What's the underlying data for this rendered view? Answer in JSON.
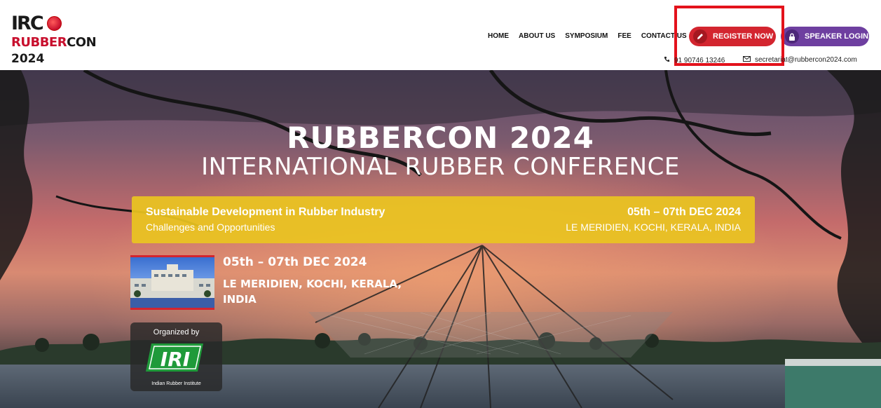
{
  "logo": {
    "line1": "IRC",
    "line2_red": "RUBBER",
    "line2_dark": "CON",
    "line3": "2024"
  },
  "nav": {
    "items": [
      "HOME",
      "ABOUT US",
      "SYMPOSIUM",
      "FEE",
      "CONTACT US"
    ]
  },
  "buttons": {
    "register": "REGISTER NOW",
    "speaker": "SPEAKER LOGIN"
  },
  "contact": {
    "phone": "91 90746 13246",
    "email": "secretariat@rubbercon2024.com"
  },
  "hero": {
    "title": "RUBBERCON 2024",
    "subtitle": "INTERNATIONAL RUBBER CONFERENCE",
    "banner": {
      "left_line1": "Sustainable Development in Rubber Industry",
      "left_line2": "Challenges and Opportunities",
      "right_line1": "05th – 07th DEC 2024",
      "right_line2": "LE MERIDIEN, KOCHI, KERALA, INDIA"
    },
    "venue": {
      "date": "05th – 07th DEC 2024",
      "place_line1": "LE MERIDIEN, KOCHI, KERALA,",
      "place_line2": "INDIA"
    },
    "organizer": {
      "label": "Organized by",
      "logo_text": "IRI",
      "name": "Indian Rubber Institute"
    }
  },
  "colors": {
    "brand_red": "#d3252f",
    "brand_purple": "#6e3fa0",
    "banner_yellow": "#e9c420",
    "highlight_box": "#e3121b"
  },
  "icons": {
    "register": "pencil-icon",
    "speaker": "lock-icon",
    "phone": "phone-icon",
    "email": "envelope-icon"
  }
}
